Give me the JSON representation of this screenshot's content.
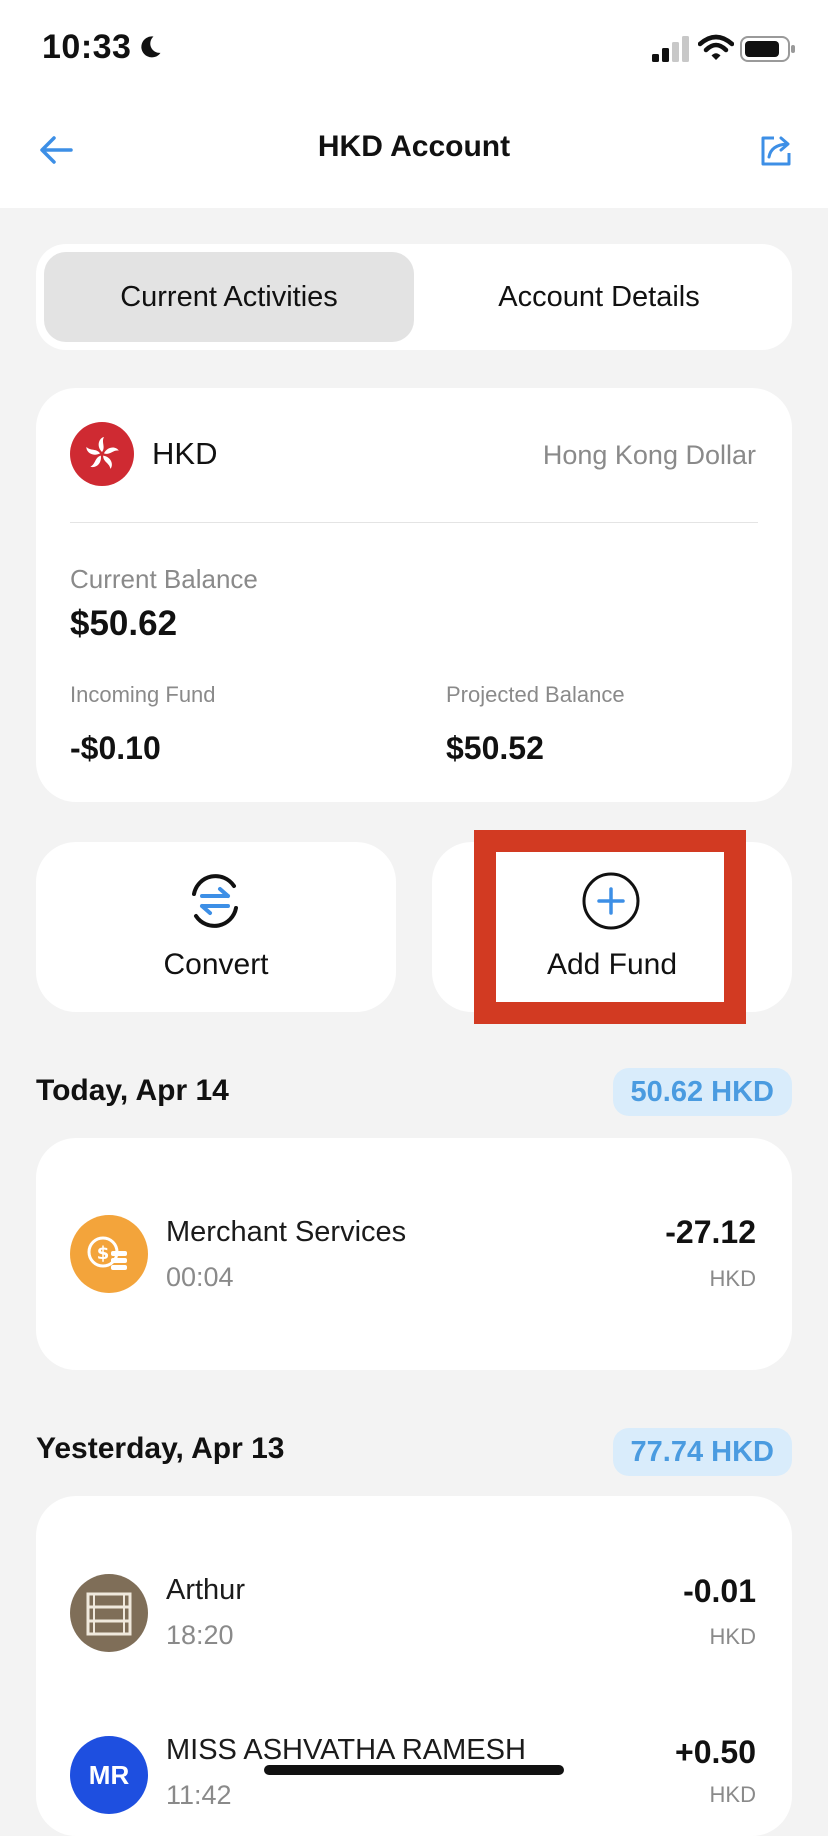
{
  "status_bar": {
    "time": "10:33"
  },
  "nav": {
    "title": "HKD Account"
  },
  "tabs": [
    {
      "label": "Current Activities",
      "active": true
    },
    {
      "label": "Account Details",
      "active": false
    }
  ],
  "account": {
    "currency_code": "HKD",
    "currency_name": "Hong Kong Dollar",
    "current_balance_label": "Current Balance",
    "current_balance": "$50.62",
    "incoming_fund_label": "Incoming Fund",
    "incoming_fund": "-$0.10",
    "projected_balance_label": "Projected Balance",
    "projected_balance": "$50.52"
  },
  "actions": {
    "convert_label": "Convert",
    "add_fund_label": "Add Fund"
  },
  "groups": [
    {
      "date": "Today, Apr 14",
      "total": "50.62 HKD",
      "transactions": [
        {
          "name": "Merchant Services",
          "time": "00:04",
          "amount": "-27.12",
          "currency": "HKD",
          "icon": "coins-icon"
        }
      ]
    },
    {
      "date": "Yesterday, Apr 13",
      "total": "77.74 HKD",
      "transactions": [
        {
          "name": "Arthur",
          "time": "18:20",
          "amount": "-0.01",
          "currency": "HKD",
          "icon": "bunk-bed-avatar"
        },
        {
          "name": "MISS ASHVATHA RAMESH",
          "time": "11:42",
          "amount": "+0.50",
          "currency": "HKD",
          "initials": "MR"
        }
      ]
    }
  ],
  "colors": {
    "accent": "#3d8fe6",
    "highlight_box": "#d23a22",
    "flag_red": "#cf2a32",
    "merchant_orange": "#f3a43b",
    "avatar_brown": "#7f6e58",
    "avatar_blue": "#1e4fe0"
  }
}
